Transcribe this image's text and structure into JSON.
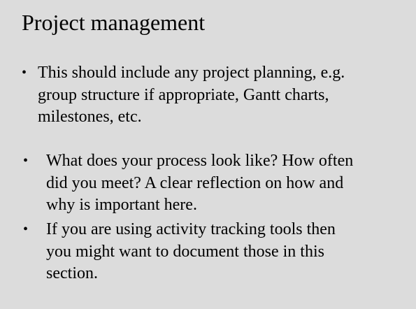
{
  "slide": {
    "title": "Project management",
    "bullets": [
      {
        "marker": "•",
        "lines": [
          "This should include any project planning, e.g.",
          "group structure if appropriate, Gantt charts,",
          "milestones, etc."
        ]
      },
      {
        "marker": "•",
        "lines": [
          "What does your process look like? How often",
          "did you meet? A clear reflection on how and",
          "why is important here."
        ]
      },
      {
        "marker": "•",
        "lines": [
          "If you are using activity tracking tools then",
          "you might want to document those in this",
          "section."
        ]
      }
    ]
  }
}
